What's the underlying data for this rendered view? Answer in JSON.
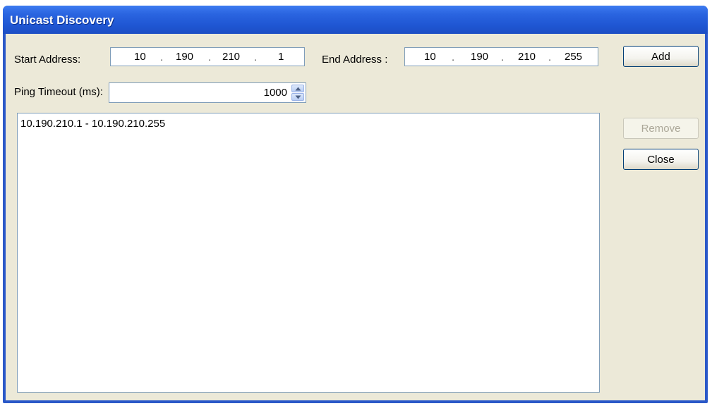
{
  "window": {
    "title": "Unicast Discovery"
  },
  "form": {
    "start_address_label": "Start Address:",
    "start_address": [
      "10",
      "190",
      "210",
      "1"
    ],
    "end_address_label": "End Address :",
    "end_address": [
      "10",
      "190",
      "210",
      "255"
    ],
    "ip_separator": ".",
    "ping_timeout_label": "Ping Timeout (ms):",
    "ping_timeout_value": "1000"
  },
  "list": {
    "items": [
      "10.190.210.1  -  10.190.210.255"
    ]
  },
  "buttons": {
    "add_label": "Add",
    "remove_label": "Remove",
    "close_label": "Close"
  },
  "colors": {
    "titlebar": "#1f56d3",
    "client_background": "#ece9d8",
    "input_border": "#7f9db9"
  },
  "icons": {
    "spin_up": "triangle-up-icon",
    "spin_down": "triangle-down-icon"
  }
}
